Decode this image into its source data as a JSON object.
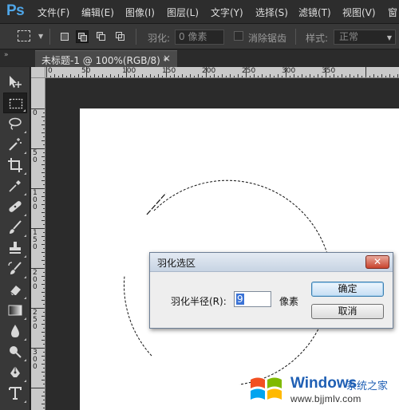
{
  "app": {
    "logo": "Ps",
    "menu": [
      "文件(F)",
      "编辑(E)",
      "图像(I)",
      "图层(L)",
      "文字(Y)",
      "选择(S)",
      "滤镜(T)",
      "视图(V)",
      "窗"
    ]
  },
  "options_bar": {
    "feather_label": "羽化:",
    "feather_value": "0 像素",
    "antialias_label": "消除锯齿",
    "antialias_checked": false,
    "style_label": "样式:",
    "style_value": "正常"
  },
  "document": {
    "tab_title": "未标题-1 @ 100%(RGB/8) *",
    "close_glyph": "×",
    "background_color": "#ffffff"
  },
  "toolbar": {
    "collapse_glyph": "»",
    "tools": [
      {
        "name": "move-tool",
        "active": false
      },
      {
        "name": "marquee-tool",
        "active": true
      },
      {
        "name": "lasso-tool",
        "active": false
      },
      {
        "name": "magic-wand-tool",
        "active": false
      },
      {
        "name": "crop-tool",
        "active": false
      },
      {
        "name": "eyedropper-tool",
        "active": false
      },
      {
        "name": "healing-brush-tool",
        "active": false
      },
      {
        "name": "brush-tool",
        "active": false
      },
      {
        "name": "clone-stamp-tool",
        "active": false
      },
      {
        "name": "history-brush-tool",
        "active": false
      },
      {
        "name": "eraser-tool",
        "active": false
      },
      {
        "name": "gradient-tool",
        "active": false
      },
      {
        "name": "blur-tool",
        "active": false
      },
      {
        "name": "dodge-tool",
        "active": false
      },
      {
        "name": "pen-tool",
        "active": false
      },
      {
        "name": "type-tool",
        "active": false
      }
    ]
  },
  "rulers": {
    "top_labels": [
      "0",
      "50",
      "100",
      "150",
      "200",
      "250",
      "300",
      "350"
    ],
    "left_labels": [
      "0",
      "50",
      "100",
      "150",
      "200",
      "250",
      "300"
    ]
  },
  "dialog": {
    "title": "羽化选区",
    "close_glyph": "✕",
    "radius_label": "羽化半径(R):",
    "radius_value": "9",
    "unit": "像素",
    "ok_label": "确定",
    "cancel_label": "取消"
  },
  "watermark": {
    "brand": "Windows",
    "cn": "系统之家",
    "url": "www.bjjmlv.com"
  },
  "colors": {
    "ps_blue": "#4fa6e8",
    "panel": "#383838",
    "workspace": "#282828",
    "watermark_blue": "#1f5fb4"
  }
}
